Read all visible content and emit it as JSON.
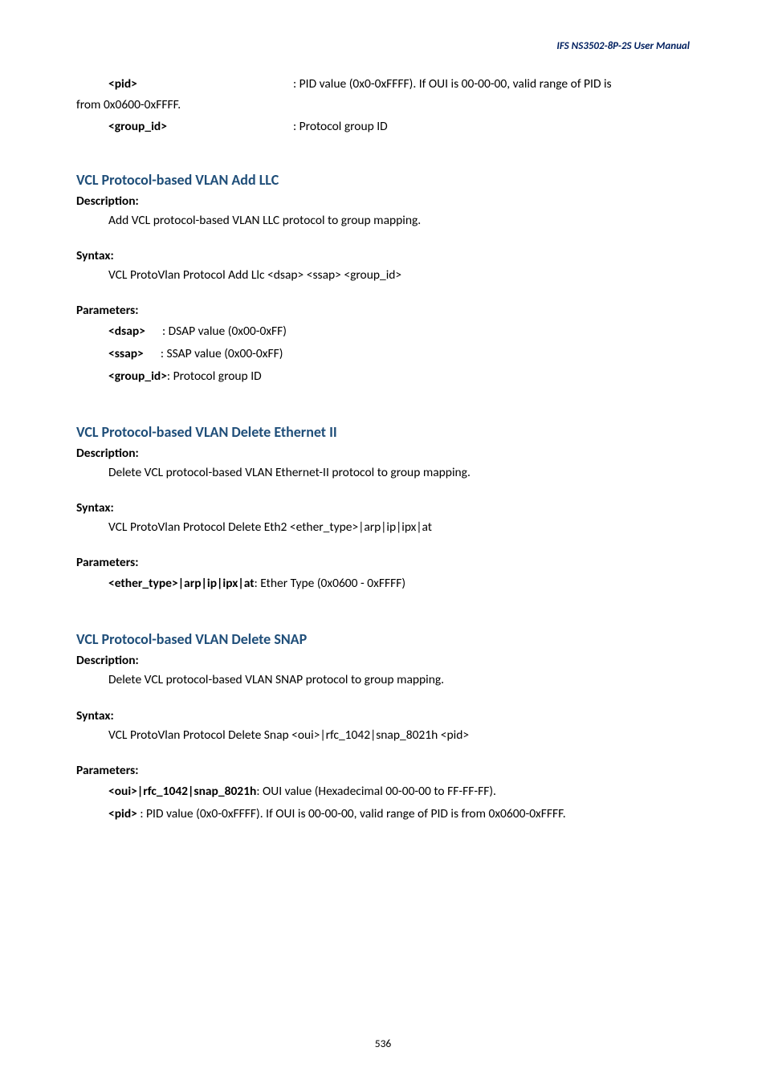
{
  "header": {
    "title": "IFS  NS3502-8P-2S  User  Manual"
  },
  "top_params": {
    "pid_key": "<pid>",
    "pid_desc": ": PID value (0x0-0xFFFF). If OUI is 00-00-00, valid range of PID is",
    "continuation": "from 0x0600-0xFFFF.",
    "group_key": "<group_id>",
    "group_desc": ": Protocol group ID"
  },
  "sections": {
    "addllc": {
      "heading": "VCL Protocol-based VLAN Add LLC",
      "desc_label": "Description:",
      "desc_text": "Add VCL protocol-based VLAN LLC protocol to group mapping.",
      "syntax_label": "Syntax:",
      "syntax_text": "VCL ProtoVlan Protocol Add Llc <dsap> <ssap> <group_id>",
      "params_label": "Parameters:",
      "params": [
        {
          "key": "<dsap>",
          "desc": ": DSAP value (0x00-0xFF)"
        },
        {
          "key": "<ssap>",
          "desc": ": SSAP value (0x00-0xFF)"
        },
        {
          "key": "<group_id>",
          "desc": ": Protocol group ID"
        }
      ]
    },
    "deleth2": {
      "heading": "VCL Protocol-based VLAN Delete Ethernet II",
      "desc_label": "Description:",
      "desc_text": "Delete VCL protocol-based VLAN Ethernet-II protocol to group mapping.",
      "syntax_label": "Syntax:",
      "syntax_text": "VCL ProtoVlan Protocol Delete Eth2 <ether_type>|arp|ip|ipx|at",
      "params_label": "Parameters:",
      "param_key": "<ether_type>|arp|ip|ipx|at",
      "param_desc": ": Ether Type (0x0600 - 0xFFFF)"
    },
    "delsnap": {
      "heading": "VCL Protocol-based VLAN Delete SNAP",
      "desc_label": "Description:",
      "desc_text": "Delete VCL protocol-based VLAN SNAP protocol to group mapping.",
      "syntax_label": "Syntax:",
      "syntax_text": "VCL ProtoVlan Protocol Delete Snap <oui>|rfc_1042|snap_8021h <pid>",
      "params_label": "Parameters:",
      "p1_key": "<oui>|rfc_1042|snap_8021h",
      "p1_desc": ": OUI value (Hexadecimal 00-00-00 to FF-FF-FF).",
      "p2_key": "<pid>",
      "p2_desc": " : PID value (0x0-0xFFFF). If OUI is 00-00-00, valid range of PID is from 0x0600-0xFFFF."
    }
  },
  "footer": {
    "page_number": "536"
  }
}
